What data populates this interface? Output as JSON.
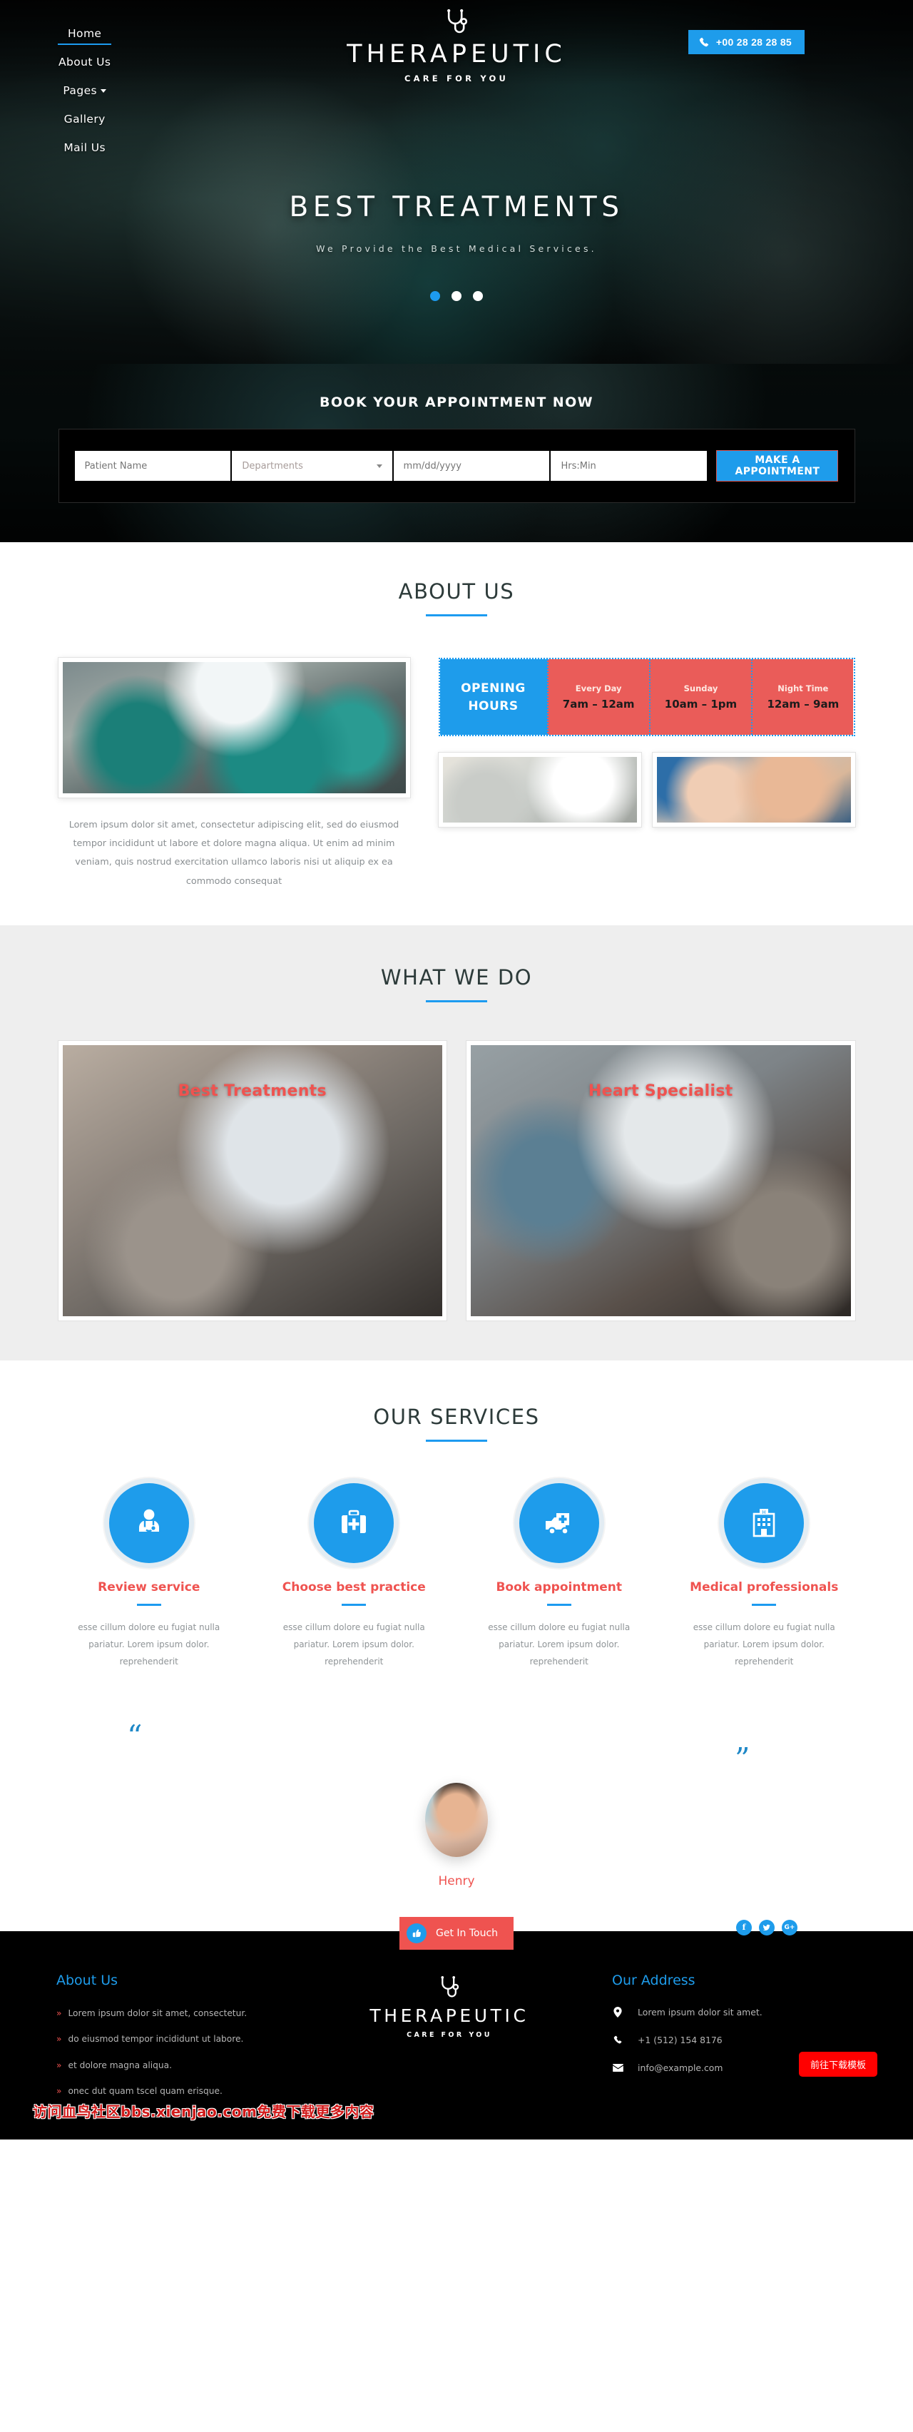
{
  "brand": {
    "name": "THERAPEUTIC",
    "tagline": "CARE FOR YOU",
    "icon": "stethoscope-icon"
  },
  "nav": {
    "items": [
      {
        "label": "Home",
        "active": true
      },
      {
        "label": "About Us",
        "active": false
      },
      {
        "label": "Pages",
        "active": false,
        "caret": true
      },
      {
        "label": "Gallery",
        "active": false
      },
      {
        "label": "Mail Us",
        "active": false
      }
    ]
  },
  "header": {
    "phone_label": "+00 28 28 28 85",
    "phone_icon": "phone-icon"
  },
  "hero": {
    "title": "BEST TREATMENTS",
    "subtitle": "We Provide the Best Medical Services.",
    "slides": [
      {
        "active": true
      },
      {
        "active": false
      },
      {
        "active": false
      }
    ]
  },
  "appointment": {
    "title": "BOOK YOUR APPOINTMENT NOW",
    "name_placeholder": "Patient Name",
    "name_value": "",
    "department_value": "Departments",
    "date_placeholder": "mm/dd/yyyy",
    "time_placeholder": "Hrs:Min",
    "submit_label": "MAKE A APPOINTMENT"
  },
  "about": {
    "title": "ABOUT US",
    "paragraph": "Lorem ipsum dolor sit amet, consectetur adipiscing elit, sed do eiusmod tempor incididunt ut labore et dolore magna aliqua. Ut enim ad minim veniam, quis nostrud exercitation ullamco laboris nisi ut aliquip ex ea commodo consequat",
    "hours_label_line1": "OPENING",
    "hours_label_line2": "HOURS",
    "hours": [
      {
        "day": "Every Day",
        "time": "7am – 12am"
      },
      {
        "day": "Sunday",
        "time": "10am – 1pm"
      },
      {
        "day": "Night Time",
        "time": "12am – 9am"
      }
    ]
  },
  "what_we_do": {
    "title": "WHAT WE DO",
    "cards": [
      {
        "label": "Best Treatments"
      },
      {
        "label": "Heart Specialist"
      }
    ]
  },
  "services": {
    "title": "OUR SERVICES",
    "items": [
      {
        "title": "Review service",
        "icon": "doctor-icon",
        "text": "esse cillum dolore eu fugiat nulla pariatur. Lorem ipsum dolor. reprehenderit"
      },
      {
        "title": "Choose best practice",
        "icon": "first-aid-kit-icon",
        "text": "esse cillum dolore eu fugiat nulla pariatur. Lorem ipsum dolor. reprehenderit"
      },
      {
        "title": "Book appointment",
        "icon": "ambulance-icon",
        "text": "esse cillum dolore eu fugiat nulla pariatur. Lorem ipsum dolor. reprehenderit"
      },
      {
        "title": "Medical professionals",
        "icon": "hospital-icon",
        "text": "esse cillum dolore eu fugiat nulla pariatur. Lorem ipsum dolor. reprehenderit"
      }
    ]
  },
  "testimonial": {
    "quote_open": "“",
    "quote_close": "”",
    "name": "Henry"
  },
  "get_in_touch": {
    "label": "Get In Touch",
    "icon": "thumbs-up-icon"
  },
  "socials": [
    {
      "name": "facebook-icon",
      "glyph": "f"
    },
    {
      "name": "twitter-icon",
      "glyph": "ᴠ"
    },
    {
      "name": "google-plus-icon",
      "glyph": "G+"
    }
  ],
  "footer": {
    "about_title": "About Us",
    "about_items": [
      "Lorem ipsum dolor sit amet, consectetur.",
      "do eiusmod tempor incididunt ut labore.",
      "et dolore magna aliqua.",
      "onec dut quam tscel quam erisque."
    ],
    "address_title": "Our Address",
    "address": "Lorem ipsum dolor sit amet.",
    "phone": "+1 (512) 154 8176",
    "email": "info@example.com"
  },
  "overlay": {
    "watermark": "访问血鸟社区bbs.xienjao.com免费下载更多内容",
    "download_label": "前往下载模板"
  },
  "colors": {
    "accent_blue": "#1e9ceb",
    "accent_red": "#ef5350",
    "dark": "#000000"
  }
}
